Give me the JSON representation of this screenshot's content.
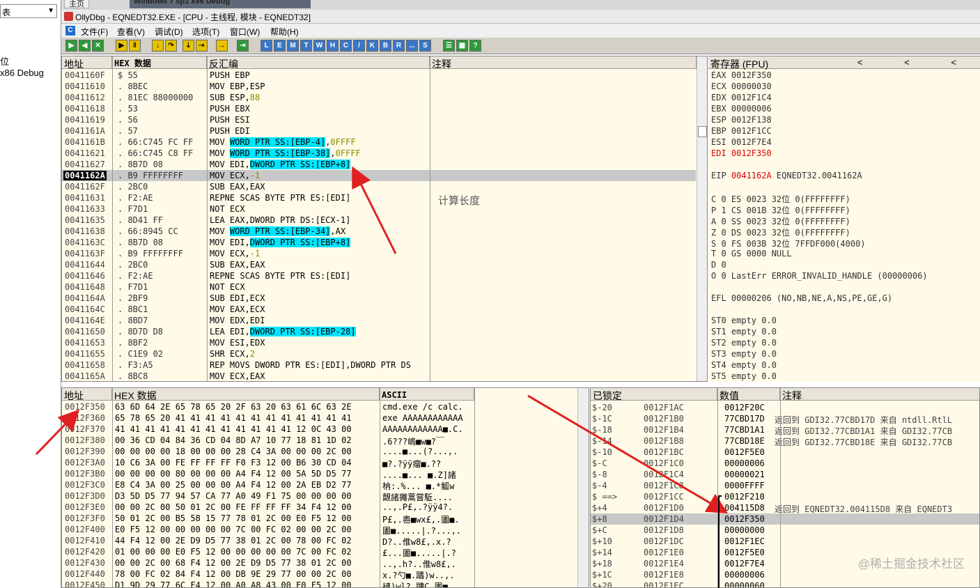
{
  "host": {
    "combo_text": "表",
    "item1": "位",
    "item2": "x86 Debug"
  },
  "vm_tabs": {
    "home": "主页",
    "vm": "Windows 7 sp1 x86 Debug"
  },
  "window_title": "OllyDbg - EQNEDT32.EXE - [CPU - 主线程, 模块 - EQNEDT32]",
  "menu_icon": "C",
  "menus": [
    "文件(F)",
    "查看(V)",
    "调试(D)",
    "选项(T)",
    "窗口(W)",
    "帮助(H)"
  ],
  "toolbar_letters": [
    "L",
    "E",
    "M",
    "T",
    "W",
    "H",
    "C",
    "/",
    "K",
    "B",
    "R",
    "...",
    "S"
  ],
  "cpu_headers": {
    "addr": "地址",
    "hex": "HEX 数据",
    "disasm": "反汇编",
    "comment": "注释"
  },
  "cpu_comment": "计算长度",
  "disasm_rows": [
    {
      "addr": "0041160F",
      "hex": "$  55",
      "parts": [
        [
          "PUSH EBP",
          ""
        ]
      ]
    },
    {
      "addr": "00411610",
      "hex": ".  8BEC",
      "parts": [
        [
          "MOV EBP,ESP",
          ""
        ]
      ]
    },
    {
      "addr": "00411612",
      "hex": ".  81EC 88000000",
      "parts": [
        [
          "SUB ESP,",
          ""
        ],
        [
          "88",
          "n"
        ]
      ]
    },
    {
      "addr": "00411618",
      "hex": ".  53",
      "parts": [
        [
          "PUSH EBX",
          ""
        ]
      ]
    },
    {
      "addr": "00411619",
      "hex": ".  56",
      "parts": [
        [
          "PUSH ESI",
          ""
        ]
      ]
    },
    {
      "addr": "0041161A",
      "hex": ".  57",
      "parts": [
        [
          "PUSH EDI",
          ""
        ]
      ]
    },
    {
      "addr": "0041161B",
      "hex": ".  66:C745 FC FF",
      "parts": [
        [
          "MOV ",
          ""
        ],
        [
          "WORD PTR SS:[EBP-4]",
          "h"
        ],
        [
          ",",
          ""
        ],
        [
          "0FFFF",
          "n"
        ]
      ]
    },
    {
      "addr": "00411621",
      "hex": ".  66:C745 C8 FF",
      "parts": [
        [
          "MOV ",
          ""
        ],
        [
          "WORD PTR SS:[EBP-38]",
          "h"
        ],
        [
          ",",
          ""
        ],
        [
          "0FFFF",
          "n"
        ]
      ]
    },
    {
      "addr": "00411627",
      "hex": ".  8B7D 08",
      "parts": [
        [
          "MOV EDI,",
          ""
        ],
        [
          "DWORD PTR SS:[EBP+8]",
          "h"
        ]
      ]
    },
    {
      "addr": "0041162A",
      "hex": ".  B9 FFFFFFFF",
      "parts": [
        [
          "MOV ECX,",
          ""
        ],
        [
          "-1",
          "n"
        ]
      ],
      "current": true
    },
    {
      "addr": "0041162F",
      "hex": ".  2BC0",
      "parts": [
        [
          "SUB EAX,EAX",
          ""
        ]
      ]
    },
    {
      "addr": "00411631",
      "hex": ".  F2:AE",
      "parts": [
        [
          "REPNE SCAS BYTE PTR ES:[EDI]",
          ""
        ]
      ]
    },
    {
      "addr": "00411633",
      "hex": ".  F7D1",
      "parts": [
        [
          "NOT ECX",
          ""
        ]
      ]
    },
    {
      "addr": "00411635",
      "hex": ".  8D41 FF",
      "parts": [
        [
          "LEA EAX,DWORD PTR DS:[ECX-1]",
          ""
        ]
      ]
    },
    {
      "addr": "00411638",
      "hex": ".  66:8945 CC",
      "parts": [
        [
          "MOV ",
          ""
        ],
        [
          "WORD PTR SS:[EBP-34]",
          "h"
        ],
        [
          ",AX",
          ""
        ]
      ]
    },
    {
      "addr": "0041163C",
      "hex": ".  8B7D 08",
      "parts": [
        [
          "MOV EDI,",
          ""
        ],
        [
          "DWORD PTR SS:[EBP+8]",
          "h"
        ]
      ]
    },
    {
      "addr": "0041163F",
      "hex": ".  B9 FFFFFFFF",
      "parts": [
        [
          "MOV ECX,",
          ""
        ],
        [
          "-1",
          "n"
        ]
      ]
    },
    {
      "addr": "00411644",
      "hex": ".  2BC0",
      "parts": [
        [
          "SUB EAX,EAX",
          ""
        ]
      ]
    },
    {
      "addr": "00411646",
      "hex": ".  F2:AE",
      "parts": [
        [
          "REPNE SCAS BYTE PTR ES:[EDI]",
          ""
        ]
      ]
    },
    {
      "addr": "00411648",
      "hex": ".  F7D1",
      "parts": [
        [
          "NOT ECX",
          ""
        ]
      ]
    },
    {
      "addr": "0041164A",
      "hex": ".  2BF9",
      "parts": [
        [
          "SUB EDI,ECX",
          ""
        ]
      ]
    },
    {
      "addr": "0041164C",
      "hex": ".  8BC1",
      "parts": [
        [
          "MOV EAX,ECX",
          ""
        ]
      ]
    },
    {
      "addr": "0041164E",
      "hex": ".  8BD7",
      "parts": [
        [
          "MOV EDX,EDI",
          ""
        ]
      ]
    },
    {
      "addr": "00411650",
      "hex": ".  8D7D D8",
      "parts": [
        [
          "LEA EDI,",
          ""
        ],
        [
          "DWORD PTR SS:[EBP-28]",
          "h"
        ]
      ]
    },
    {
      "addr": "00411653",
      "hex": ".  8BF2",
      "parts": [
        [
          "MOV ESI,EDX",
          ""
        ]
      ]
    },
    {
      "addr": "00411655",
      "hex": ".  C1E9 02",
      "parts": [
        [
          "SHR ECX,",
          ""
        ],
        [
          "2",
          "n"
        ]
      ]
    },
    {
      "addr": "00411658",
      "hex": ".  F3:A5",
      "parts": [
        [
          "REP MOVS DWORD PTR ES:[EDI],DWORD PTR DS",
          ""
        ]
      ]
    },
    {
      "addr": "0041165A",
      "hex": ".  8BC8",
      "parts": [
        [
          "MOV ECX,EAX",
          ""
        ]
      ]
    }
  ],
  "regs_header": "寄存器 (FPU)",
  "regs_nav": "< < <",
  "registers": [
    {
      "t": "EAX 0012F350"
    },
    {
      "t": "ECX 00000030"
    },
    {
      "t": "EDX 0012F1C4"
    },
    {
      "t": "EBX 00000006"
    },
    {
      "t": "ESP 0012F138"
    },
    {
      "t": "EBP 0012F1CC"
    },
    {
      "t": "ESI 0012F7E4"
    },
    {
      "t": "EDI 0012F350",
      "red": true
    },
    {
      "t": ""
    },
    {
      "t": "EIP 0041162A EQNEDT32.0041162A",
      "redpart": "0041162A"
    },
    {
      "t": ""
    },
    {
      "t": "C 0  ES 0023 32位 0(FFFFFFFF)"
    },
    {
      "t": "P 1  CS 001B 32位 0(FFFFFFFF)"
    },
    {
      "t": "A 0  SS 0023 32位 0(FFFFFFFF)"
    },
    {
      "t": "Z 0  DS 0023 32位 0(FFFFFFFF)"
    },
    {
      "t": "S 0  FS 003B 32位 7FFDF000(4000)"
    },
    {
      "t": "T 0  GS 0000 NULL"
    },
    {
      "t": "D 0"
    },
    {
      "t": "O 0  LastErr ERROR_INVALID_HANDLE (00000006)"
    },
    {
      "t": ""
    },
    {
      "t": "EFL 00000206 (NO,NB,NE,A,NS,PE,GE,G)"
    },
    {
      "t": ""
    },
    {
      "t": "ST0 empty 0.0"
    },
    {
      "t": "ST1 empty 0.0"
    },
    {
      "t": "ST2 empty 0.0"
    },
    {
      "t": "ST3 empty 0.0"
    },
    {
      "t": "ST4 empty 0.0"
    },
    {
      "t": "ST5 empty 0.0"
    },
    {
      "t": "ST6 empty 0.0"
    },
    {
      "t": "ST7 empty 0.0"
    }
  ],
  "dump_headers": {
    "addr": "地址",
    "hex": "HEX 数据",
    "ascii": "ASCII"
  },
  "dump_rows": [
    {
      "a": "0012F350",
      "h": "63 6D 64 2E 65 78 65 20 2F 63 20 63 61 6C 63 2E",
      "s": "cmd.exe /c calc."
    },
    {
      "a": "0012F360",
      "h": "65 78 65 20 41 41 41 41 41 41 41 41 41 41 41 41",
      "s": "exe AAAAAAAAAAAA"
    },
    {
      "a": "0012F370",
      "h": "41 41 41 41 41 41 41 41 41 41 41 41 12 0C 43 00",
      "s": "AAAAAAAAAAAA■.C."
    },
    {
      "a": "0012F380",
      "h": "00 36 CD 04 84 36 CD 04 8D A7 10 77 18 81 1D 02",
      "s": ".6???嶋■w■?￣"
    },
    {
      "a": "0012F390",
      "h": "00 00 00 00 18 00 00 00 28 C4 3A 00 00 00 2C 00",
      "s": "....■...(?...,."
    },
    {
      "a": "0012F3A0",
      "h": "10 C6 3A 00 FE FF FF FF F0 F3 12 00 B6 30 CD 04",
      "s": "■?.?ÿÿ瘤■.??"
    },
    {
      "a": "0012F3B0",
      "h": "00 00 00 00 80 00 00 00 A4 F4 12 00 5A 5D D5 77",
      "s": "....■...  ■.Z]諸"
    },
    {
      "a": "0012F3C0",
      "h": "E8 C4 3A 00 25 00 00 00 A4 F4 12 00 2A EB D2 77",
      "s": "枘:.%...  ■.*觚w"
    },
    {
      "a": "0012F3D0",
      "h": "D3 5D D5 77 94 57 CA 77 A0 49 F1 75 00 00 00 00",
      "s": "覿諸攡蒿嘗駈...."
    },
    {
      "a": "0012F3E0",
      "h": "00 00 2C 00 50 01 2C 00 FE FF FF FF 34 F4 12 00",
      "s": "..,.P£,.?ÿÿ4?."
    },
    {
      "a": "0012F3F0",
      "h": "50 01 2C 00 B5 58 15 77 78 01 2C 00 E0 F5 12 00",
      "s": "P£,.嶴■wx£,.圕■."
    },
    {
      "a": "0012F400",
      "h": "E0 F5 12 00 00 00 00 00 7C 00 FC 02 00 00 2C 00",
      "s": "圕■.....|.?...,."
    },
    {
      "a": "0012F410",
      "h": "44 F4 12 00 2E D9 D5 77 38 01 2C 00 78 00 FC 02",
      "s": "D?..倠w8£,.x.?"
    },
    {
      "a": "0012F420",
      "h": "01 00 00 00 E0 F5 12 00 00 00 00 00 7C 00 FC 02",
      "s": "£...圕■.....|.?"
    },
    {
      "a": "0012F430",
      "h": "00 00 2C 00 68 F4 12 00 2E D9 D5 77 38 01 2C 00",
      "s": "..,.h?..倠w8£,."
    },
    {
      "a": "0012F440",
      "h": "78 00 FC 02 84 F4 12 00 DB 9E 29 77 00 00 2C 00",
      "s": "x.?勺■.蹫)w..,."
    },
    {
      "a": "0012F450",
      "h": "D1 9D 29 77 6C F4 12 00 A0 A8 43 00 E0 F5 12 00",
      "s": "褳)wl?.牗C.圕■."
    }
  ],
  "stack_headers": {
    "locked": "已锁定",
    "value": "数值",
    "comment": "注释"
  },
  "stack_rows": [
    {
      "o": "$-20",
      "a": "0012F1AC",
      "v": "0012F20C",
      "c": ""
    },
    {
      "o": "$-1C",
      "a": "0012F1B0",
      "v": "77CBD17D",
      "c": "返回到 GDI32.77CBD17D 来自 ntdll.RtlL"
    },
    {
      "o": "$-18",
      "a": "0012F1B4",
      "v": "77CBD1A1",
      "c": "返回到 GDI32.77CBD1A1 来自 GDI32.77CB"
    },
    {
      "o": "$-14",
      "a": "0012F1B8",
      "v": "77CBD18E",
      "c": "返回到 GDI32.77CBD18E 来自 GDI32.77CB"
    },
    {
      "o": "$-10",
      "a": "0012F1BC",
      "v": "0012F5E0",
      "c": ""
    },
    {
      "o": "$-C",
      "a": "0012F1C0",
      "v": "00000006",
      "c": ""
    },
    {
      "o": "$-8",
      "a": "0012F1C4",
      "v": "00000021",
      "c": ""
    },
    {
      "o": "$-4",
      "a": "0012F1C8",
      "v": "0000FFFF",
      "c": ""
    },
    {
      "o": "$ ==>",
      "a": "0012F1CC",
      "v": "0012F210",
      "c": ""
    },
    {
      "o": "$+4",
      "a": "0012F1D0",
      "v": "004115D8",
      "c": "返回到 EQNEDT32.004115D8 来自 EQNEDT3"
    },
    {
      "o": "$+8",
      "a": "0012F1D4",
      "v": "0012F350",
      "c": "",
      "current": true
    },
    {
      "o": "$+C",
      "a": "0012F1D8",
      "v": "00000000",
      "c": ""
    },
    {
      "o": "$+10",
      "a": "0012F1DC",
      "v": "0012F1EC",
      "c": ""
    },
    {
      "o": "$+14",
      "a": "0012F1E0",
      "v": "0012F5E0",
      "c": ""
    },
    {
      "o": "$+18",
      "a": "0012F1E4",
      "v": "0012F7E4",
      "c": ""
    },
    {
      "o": "$+1C",
      "a": "0012F1E8",
      "v": "00000006",
      "c": ""
    },
    {
      "o": "$+20",
      "a": "0012F1EC",
      "v": "00000060",
      "c": ""
    }
  ],
  "watermark": "@稀土掘金技术社区",
  "colors": {
    "annotation_arrow": "#e02020",
    "highlight": "#00e5ff",
    "pane_bg": "#fffbe8"
  }
}
